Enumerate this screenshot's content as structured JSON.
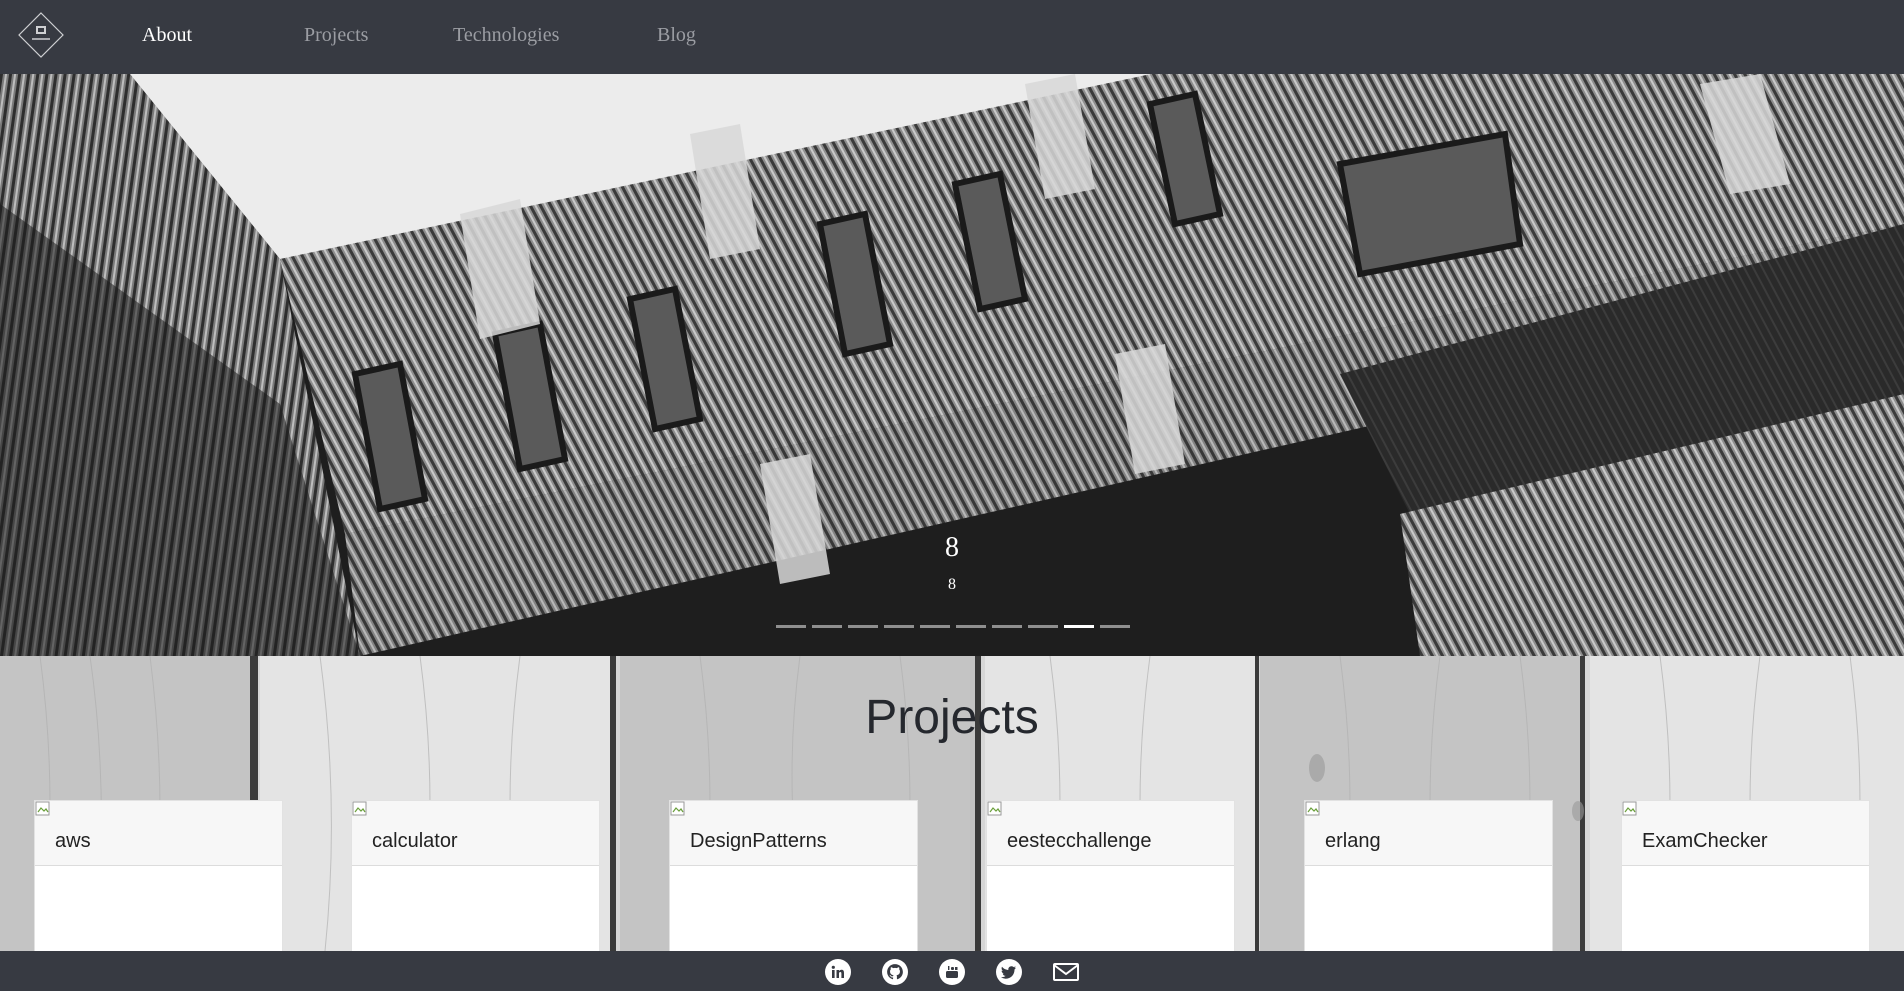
{
  "navbar": {
    "logo_icon": "brand-logo-icon",
    "links": [
      {
        "label": "About",
        "active": true
      },
      {
        "label": "Projects",
        "active": false
      },
      {
        "label": "Technologies",
        "active": false
      },
      {
        "label": "Blog",
        "active": false
      }
    ]
  },
  "carousel": {
    "caption_title": "8",
    "caption_text": "8",
    "slide_count": 10,
    "active_index": 8
  },
  "projects": {
    "heading": "Projects",
    "cards": [
      {
        "title": "aws"
      },
      {
        "title": "calculator"
      },
      {
        "title": "DesignPatterns"
      },
      {
        "title": "eestecchallenge"
      },
      {
        "title": "erlang"
      },
      {
        "title": "ExamChecker"
      }
    ]
  },
  "footer": {
    "social_icons": [
      "linkedin-icon",
      "github-icon",
      "youtube-icon",
      "twitter-icon",
      "email-icon"
    ]
  },
  "colors": {
    "navbar_bg": "#373a42",
    "nav_inactive": "#9b9da3",
    "nav_active": "#ffffff",
    "heading": "#25282e"
  }
}
